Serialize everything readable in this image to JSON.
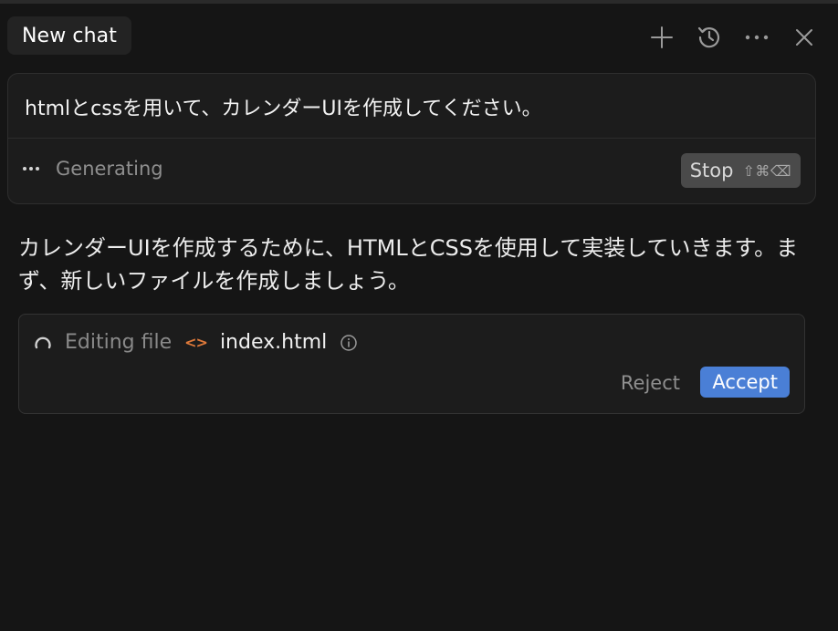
{
  "header": {
    "tab_label": "New chat",
    "icons": [
      "plus-icon",
      "history-icon",
      "more-icon",
      "close-icon"
    ]
  },
  "prompt": {
    "text": "htmlとcssを用いて、カレンダーUIを作成してください。",
    "status": "Generating",
    "stop_label": "Stop",
    "stop_shortcut": "⇧⌘⌫"
  },
  "assistant": {
    "message": "カレンダーUIを作成するために、HTMLとCSSを使用して実装していきます。まず、新しいファイルを作成しましょう。"
  },
  "edit": {
    "status": "Editing file",
    "filename": "index.html",
    "reject_label": "Reject",
    "accept_label": "Accept"
  },
  "colors": {
    "background": "#151515",
    "accent": "#4a7fd6",
    "file_icon": "#e07a3a"
  }
}
